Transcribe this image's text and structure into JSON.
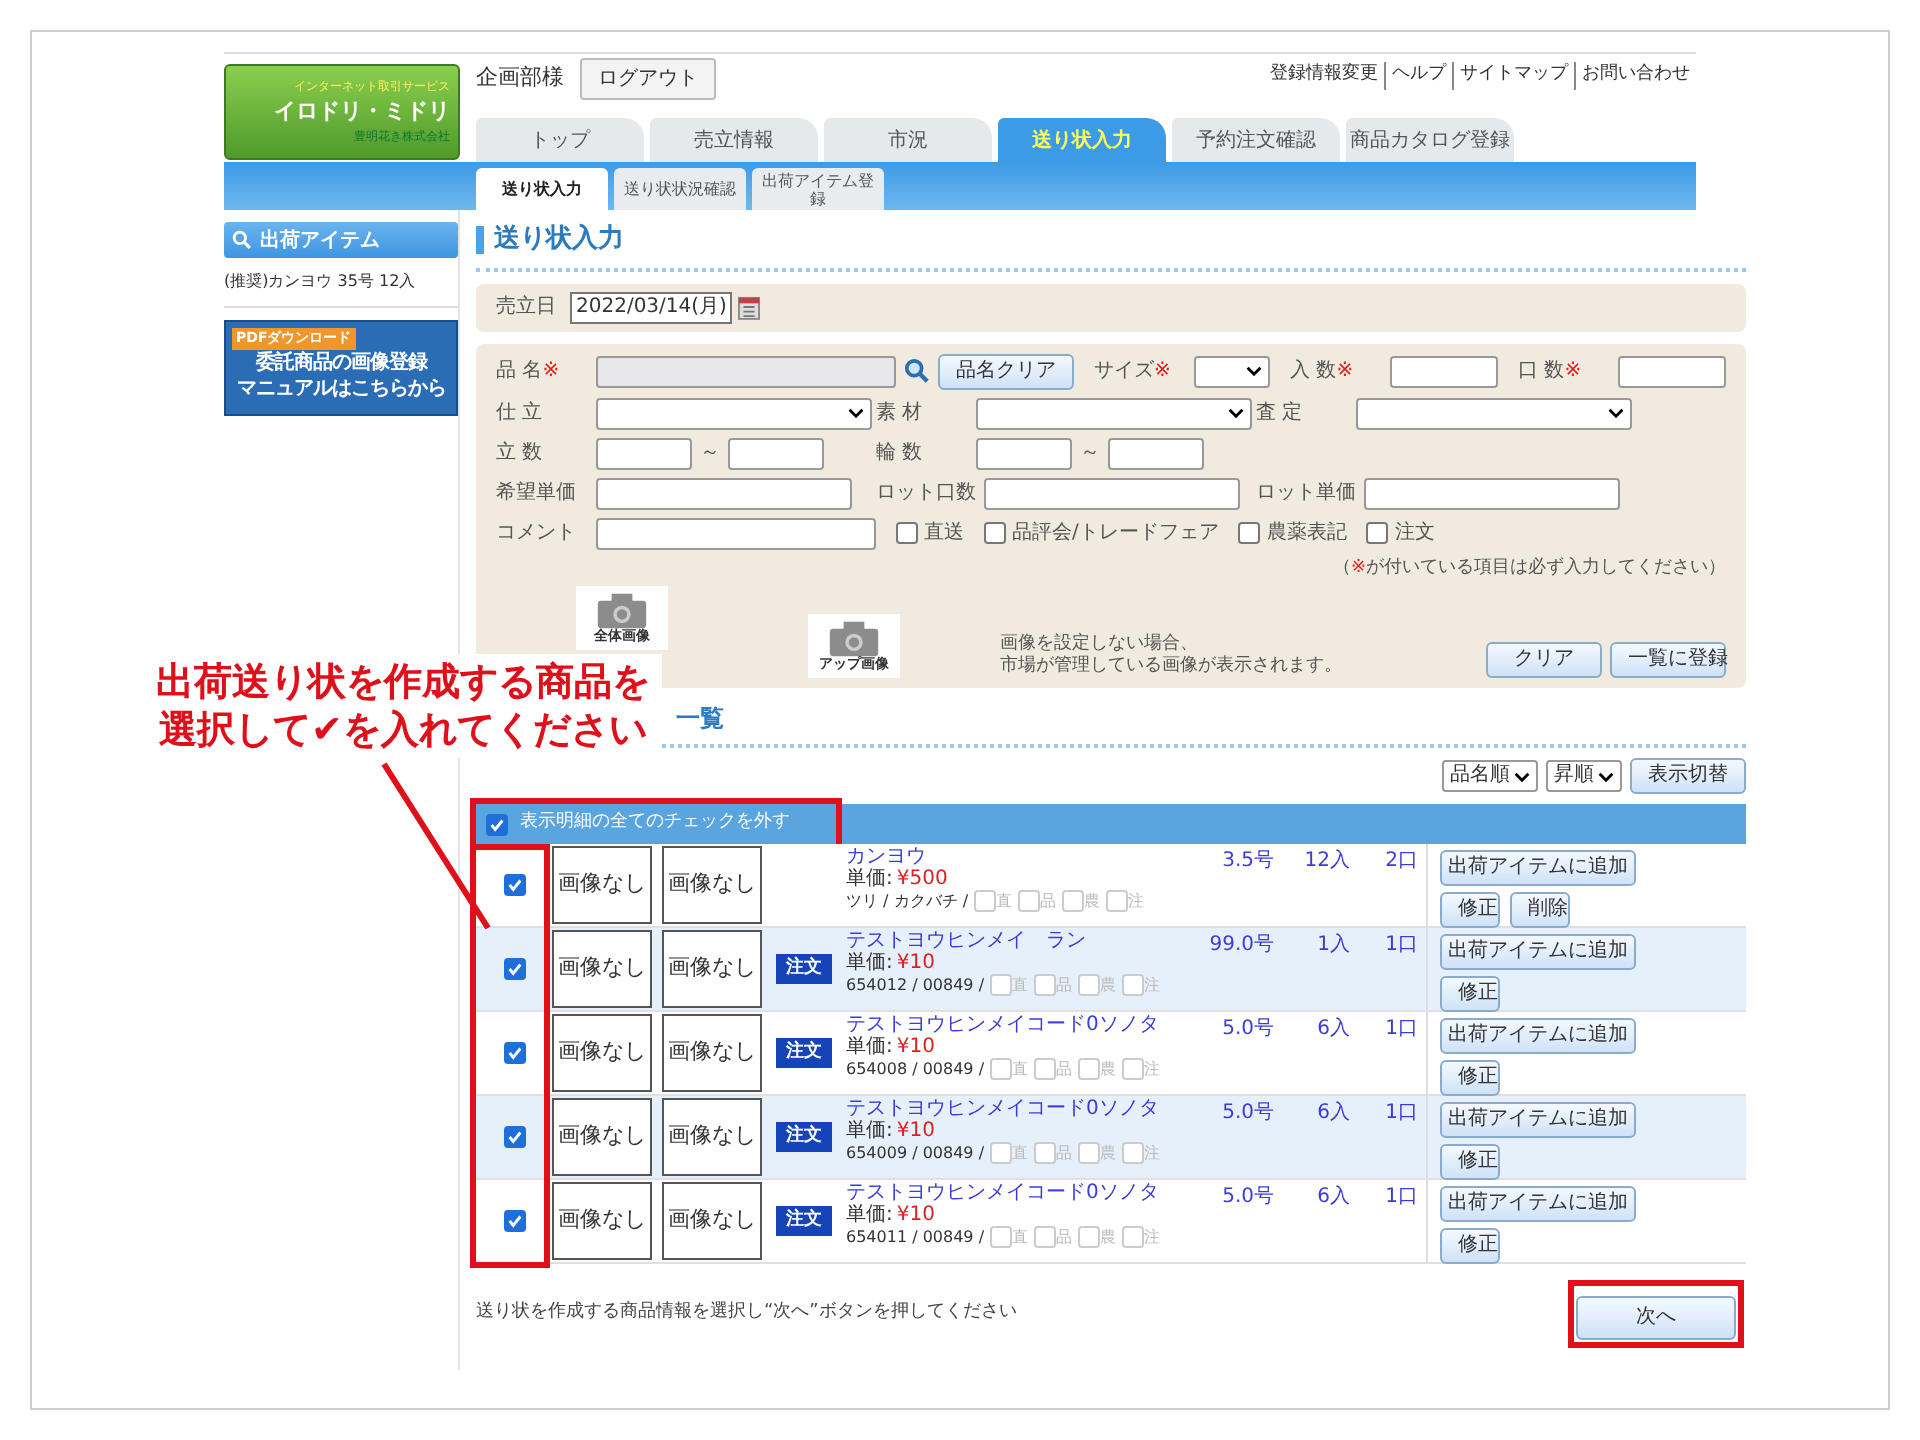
{
  "header": {
    "logo": {
      "tagline": "インターネット取引サービス",
      "name": "イロドリ・ミドリ",
      "company": "豊明花き株式会社"
    },
    "user": "企画部様",
    "logout": "ログアウト",
    "links": [
      "登録情報変更",
      "ヘルプ",
      "サイトマップ",
      "お問い合わせ"
    ]
  },
  "tabs": [
    {
      "label": "トップ",
      "selected": false
    },
    {
      "label": "売立情報",
      "selected": false
    },
    {
      "label": "市況",
      "selected": false
    },
    {
      "label": "送り状入力",
      "selected": true
    },
    {
      "label": "予約注文確認",
      "selected": false
    },
    {
      "label": "商品カタログ登録",
      "selected": false
    }
  ],
  "subtabs": [
    {
      "label": "送り状入力",
      "selected": true
    },
    {
      "label": "送り状状況確認",
      "selected": false
    },
    {
      "label": "出荷アイテム登録",
      "selected": false
    }
  ],
  "sidebar": {
    "title": "出荷アイテム",
    "items": [
      "(推奨)カンヨウ 35号 12入"
    ],
    "banner": {
      "badge": "PDFダウンロード",
      "lines": [
        "委託商品の画像登録",
        "マニュアルはこちらから"
      ]
    }
  },
  "heading": "送り状入力",
  "date": {
    "label": "売立日",
    "value": "2022/03/14(月)"
  },
  "form": {
    "rows": [
      {
        "fields": [
          {
            "kind": "search",
            "label": "品 名",
            "mark": "※",
            "button": "品名クリア",
            "disabled": true
          },
          {
            "kind": "select",
            "label": "サイズ",
            "mark": "※"
          },
          {
            "kind": "text",
            "label": "入 数",
            "mark": "※"
          },
          {
            "kind": "text",
            "label": "口 数",
            "mark": "※"
          }
        ]
      },
      {
        "fields": [
          {
            "kind": "select",
            "label": "仕 立"
          },
          {
            "kind": "select",
            "label": "素 材"
          },
          {
            "kind": "select",
            "label": "査 定"
          }
        ]
      },
      {
        "fields": [
          {
            "kind": "range",
            "label": "立 数",
            "separator": "～"
          },
          {
            "kind": "range",
            "label": "輪 数",
            "separator": "～"
          }
        ]
      },
      {
        "fields": [
          {
            "kind": "text",
            "label": "希望単価"
          },
          {
            "kind": "text",
            "label": "ロット口数"
          },
          {
            "kind": "text",
            "label": "ロット単価"
          }
        ]
      },
      {
        "fields": [
          {
            "kind": "text",
            "label": "コメント"
          }
        ]
      }
    ],
    "options": [
      {
        "label": "直送",
        "checked": false
      },
      {
        "label": "品評会/トレードフェア",
        "checked": false
      },
      {
        "label": "農薬表記",
        "checked": false
      },
      {
        "label": "注文",
        "checked": false
      }
    ],
    "note": {
      "before": "（",
      "mark": "※",
      "after": "が付いている項目は必ず入力してください）"
    },
    "images": [
      "全体画像",
      "アップ画像"
    ],
    "image_note": [
      "画像を設定しない場合、",
      "市場が管理している画像が表示されます。"
    ],
    "buttons": [
      "クリア",
      "一覧に登録"
    ]
  },
  "list": {
    "heading": "一覧",
    "sort": [
      "品名順",
      "昇順"
    ],
    "sort_button": "表示切替",
    "select_all": {
      "label": "表示明細の全てのチェックを外す",
      "checked": true
    },
    "rows": [
      {
        "checked": true,
        "images": [
          "画像なし",
          "画像なし"
        ],
        "name": "カンヨウ",
        "price_label": "単価:",
        "price": "¥500",
        "code": "ツリ / カクバチ /",
        "flags_disabled": true,
        "flags": [
          {
            "label": "直",
            "checked": false
          },
          {
            "label": "品",
            "checked": false
          },
          {
            "label": "農",
            "checked": false
          },
          {
            "label": "注",
            "checked": false
          }
        ],
        "size": "3.5号",
        "qty": "12入",
        "units": "2口",
        "actions": [
          "出荷アイテムに追加",
          "修正",
          "削除"
        ]
      },
      {
        "checked": true,
        "images": [
          "画像なし",
          "画像なし"
        ],
        "badge": "注文",
        "name": "テストヨウヒンメイ　ラン",
        "price_label": "単価:",
        "price": "¥10",
        "code": "654012 / 00849 /",
        "flags_disabled": true,
        "flags": [
          {
            "label": "直",
            "checked": false
          },
          {
            "label": "品",
            "checked": false
          },
          {
            "label": "農",
            "checked": false
          },
          {
            "label": "注",
            "checked": false
          }
        ],
        "size": "99.0号",
        "qty": "1入",
        "units": "1口",
        "actions": [
          "出荷アイテムに追加",
          "修正"
        ]
      },
      {
        "checked": true,
        "images": [
          "画像なし",
          "画像なし"
        ],
        "badge": "注文",
        "name": "テストヨウヒンメイコード0ソノタ",
        "price_label": "単価:",
        "price": "¥10",
        "code": "654008 / 00849 /",
        "flags_disabled": true,
        "flags": [
          {
            "label": "直",
            "checked": false
          },
          {
            "label": "品",
            "checked": false
          },
          {
            "label": "農",
            "checked": false
          },
          {
            "label": "注",
            "checked": false
          }
        ],
        "size": "5.0号",
        "qty": "6入",
        "units": "1口",
        "actions": [
          "出荷アイテムに追加",
          "修正"
        ]
      },
      {
        "checked": true,
        "images": [
          "画像なし",
          "画像なし"
        ],
        "badge": "注文",
        "name": "テストヨウヒンメイコード0ソノタ",
        "price_label": "単価:",
        "price": "¥10",
        "code": "654009 / 00849 /",
        "flags_disabled": true,
        "flags": [
          {
            "label": "直",
            "checked": false
          },
          {
            "label": "品",
            "checked": false
          },
          {
            "label": "農",
            "checked": false
          },
          {
            "label": "注",
            "checked": false
          }
        ],
        "size": "5.0号",
        "qty": "6入",
        "units": "1口",
        "actions": [
          "出荷アイテムに追加",
          "修正"
        ]
      },
      {
        "checked": true,
        "images": [
          "画像なし",
          "画像なし"
        ],
        "badge": "注文",
        "name": "テストヨウヒンメイコード0ソノタ",
        "price_label": "単価:",
        "price": "¥10",
        "code": "654011 / 00849 /",
        "flags_disabled": true,
        "flags": [
          {
            "label": "直",
            "checked": false
          },
          {
            "label": "品",
            "checked": false
          },
          {
            "label": "農",
            "checked": false
          },
          {
            "label": "注",
            "checked": false
          }
        ],
        "size": "5.0号",
        "qty": "6入",
        "units": "1口",
        "actions": [
          "出荷アイテムに追加",
          "修正"
        ]
      }
    ]
  },
  "footer": {
    "text": "送り状を作成する商品情報を選択し“次へ”ボタンを押してください",
    "next": "次へ"
  },
  "annotation": {
    "lines": [
      "出荷送り状を作成する商品を",
      "選択して✔を入れてください"
    ]
  }
}
